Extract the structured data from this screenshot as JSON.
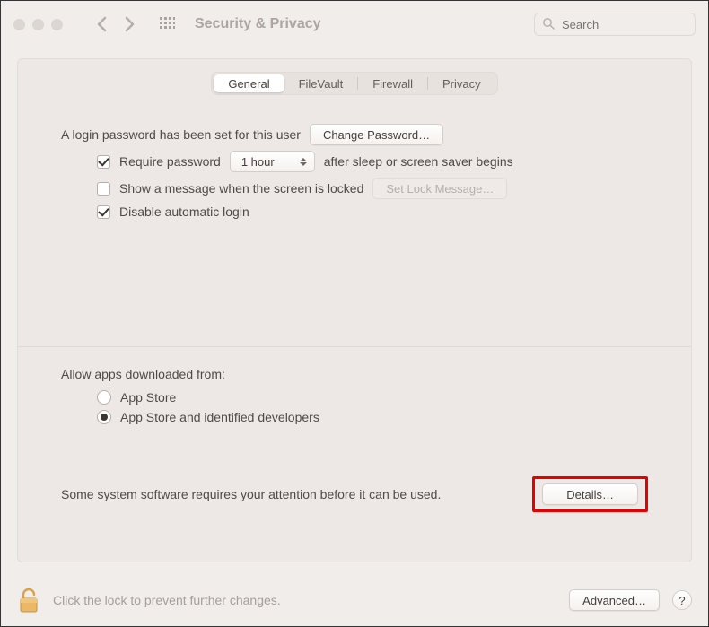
{
  "toolbar": {
    "window_title": "Security & Privacy",
    "search_placeholder": "Search"
  },
  "tabs": [
    {
      "label": "General",
      "active": true
    },
    {
      "label": "FileVault",
      "active": false
    },
    {
      "label": "Firewall",
      "active": false
    },
    {
      "label": "Privacy",
      "active": false
    }
  ],
  "login": {
    "intro": "A login password has been set for this user",
    "change_password_btn": "Change Password…",
    "require_password_label": "Require password",
    "require_password_checked": true,
    "require_password_delay": "1 hour",
    "require_password_suffix": "after sleep or screen saver begins",
    "show_message_label": "Show a message when the screen is locked",
    "show_message_checked": false,
    "set_lock_message_btn": "Set Lock Message…",
    "disable_auto_login_label": "Disable automatic login",
    "disable_auto_login_checked": true
  },
  "downloads": {
    "heading": "Allow apps downloaded from:",
    "options": [
      {
        "label": "App Store",
        "selected": false
      },
      {
        "label": "App Store and identified developers",
        "selected": true
      }
    ]
  },
  "attention": {
    "text": "Some system software requires your attention before it can be used.",
    "details_btn": "Details…"
  },
  "footer": {
    "lock_text": "Click the lock to prevent further changes.",
    "advanced_btn": "Advanced…",
    "help_btn": "?"
  }
}
